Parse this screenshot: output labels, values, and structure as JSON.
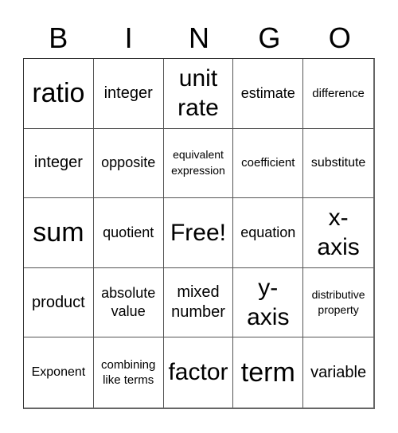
{
  "header": {
    "letters": [
      "B",
      "I",
      "N",
      "G",
      "O"
    ]
  },
  "cells": [
    "ratio",
    "integer",
    "unit rate",
    "estimate",
    "difference",
    "integer",
    "opposite",
    "equivalent expression",
    "coefficient",
    "substitute",
    "sum",
    "quotient",
    "Free!",
    "equation",
    "x- axis",
    "product",
    "absolute value",
    "mixed number",
    "y- axis",
    "distributive property",
    "Exponent",
    "combining like terms",
    "factor",
    "term",
    "variable"
  ]
}
